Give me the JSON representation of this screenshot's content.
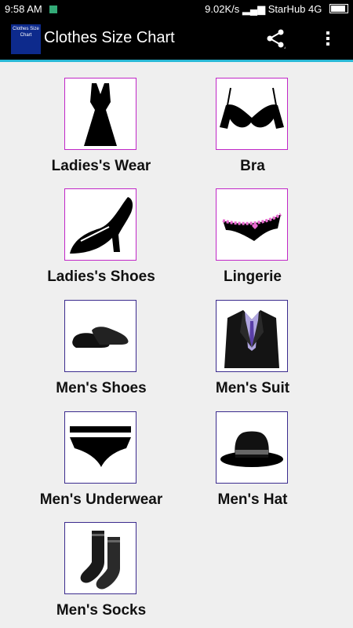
{
  "status_bar": {
    "time": "9:58 AM",
    "speed": "9.02K/s",
    "carrier": "StarHub 4G"
  },
  "app_bar": {
    "logo_text": "Clothes Size Chart",
    "title": "Clothes Size Chart"
  },
  "categories": [
    {
      "label": "Ladies's Wear",
      "icon": "dress-icon"
    },
    {
      "label": "Bra",
      "icon": "bra-icon"
    },
    {
      "label": "Ladies's Shoes",
      "icon": "high-heel-icon"
    },
    {
      "label": "Lingerie",
      "icon": "lingerie-icon"
    },
    {
      "label": "Men's Shoes",
      "icon": "men-shoes-icon"
    },
    {
      "label": "Men's Suit",
      "icon": "suit-icon"
    },
    {
      "label": "Men's Underwear",
      "icon": "underwear-icon"
    },
    {
      "label": "Men's Hat",
      "icon": "hat-icon"
    },
    {
      "label": "Men's Socks",
      "icon": "socks-icon"
    }
  ],
  "colors": {
    "accent": "#2ab9d6",
    "ladies_border": "#c026c7",
    "men_border": "#3b2b8e"
  }
}
